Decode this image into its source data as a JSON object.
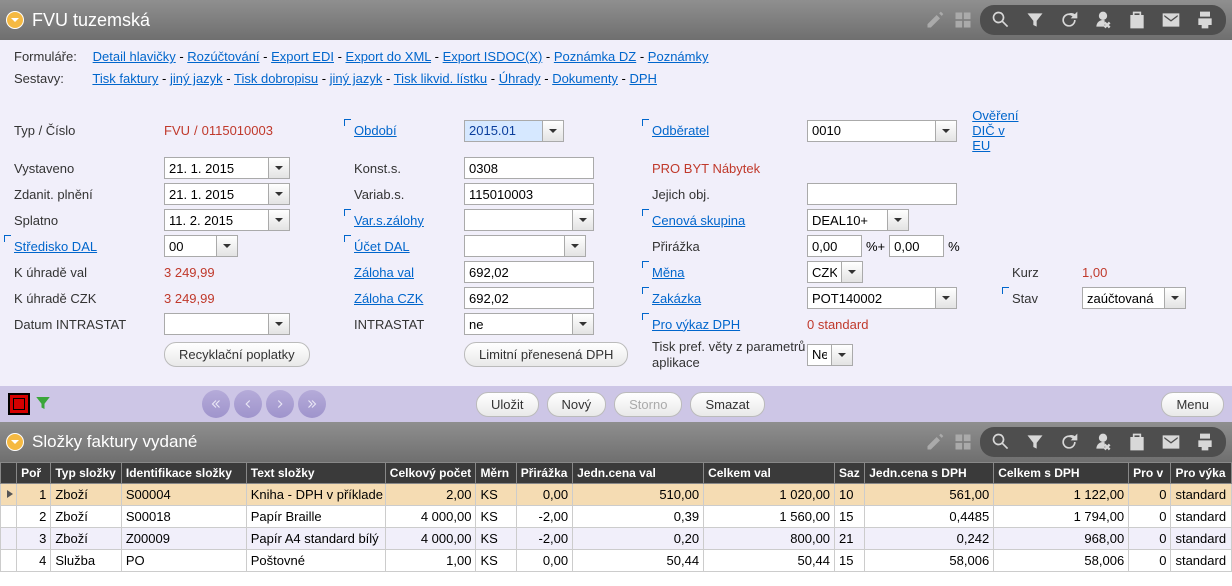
{
  "header": {
    "title": "FVU tuzemská"
  },
  "linksRow1Label": "Formuláře:",
  "linksRow1": [
    "Detail hlavičky",
    "Rozúčtování",
    "Export EDI",
    "Export do XML",
    "Export ISDOC(X)",
    "Poznámka DZ",
    "Poznámky"
  ],
  "linksRow2Label": "Sestavy:",
  "linksRow2": [
    "Tisk faktury",
    "jiný jazyk",
    "Tisk dobropisu",
    "jiný jazyk",
    "Tisk likvid. lístku",
    "Úhrady",
    "Dokumenty",
    "DPH"
  ],
  "form": {
    "typCisloLabel": "Typ / Číslo",
    "typ": "FVU",
    "cislo": "0115010003",
    "obdobiLabel": "Období",
    "obdobi": "2015.01",
    "odberatelLabel": "Odběratel",
    "odberatel": "0010",
    "overeniDicLabel": "Ověření DIČ v EU",
    "vystavenoLabel": "Vystaveno",
    "vystaveno": "21. 1. 2015",
    "konstSLabel": "Konst.s.",
    "konstS": "0308",
    "customerName": "PRO BYT Nábytek",
    "zdanitLabel": "Zdanit. plnění",
    "zdanit": "21. 1. 2015",
    "variabSLabel": "Variab.s.",
    "variabS": "115010003",
    "jejichObjLabel": "Jejich obj.",
    "jejichObj": "",
    "splatnoLabel": "Splatno",
    "splatno": "11. 2. 2015",
    "varsZalohyLabel": "Var.s.zálohy",
    "varsZalohy": "",
    "cenovaSkupinaLabel": "Cenová skupina",
    "cenovaSkupina": "DEAL10+",
    "strediskoDalLabel": "Středisko DAL",
    "strediskoDal": "00",
    "ucetDalLabel": "Účet DAL",
    "ucetDal": "",
    "prirazkaLabel": "Přirážka",
    "prirazka1": "0,00",
    "prirazkaPM": "%+",
    "prirazka2": "0,00",
    "prirazkaPct": "%",
    "kUhradeValLabel": "K úhradě val",
    "kUhradeVal": "3 249,99",
    "zalohaValLabel": "Záloha val",
    "zalohaVal": "692,02",
    "menaLabel": "Měna",
    "mena": "CZK",
    "kurzLabel": "Kurz",
    "kurz": "1,00",
    "kUhradeCzkLabel": "K úhradě CZK",
    "kUhradeCzk": "3 249,99",
    "zalohaCzkLabel": "Záloha CZK",
    "zalohaCzk": "692,02",
    "zakazkaLabel": "Zakázka",
    "zakazka": "POT140002",
    "stavLabel": "Stav",
    "stav": "zaúčtovaná",
    "datumIntrastatLabel": "Datum INTRASTAT",
    "datumIntrastat": "",
    "intrastatLabel": "INTRASTAT",
    "intrastat": "ne",
    "proVykazDphLabel": "Pro výkaz DPH",
    "proVykazDph": "0  standard",
    "recyklBtn": "Recyklační poplatky",
    "limitBtn": "Limitní přenesená DPH",
    "tiskPrefLabel": "Tisk pref. věty z parametrů aplikace",
    "tiskPref": "Ne"
  },
  "actions": {
    "save": "Uložit",
    "new": "Nový",
    "storno": "Storno",
    "delete": "Smazat",
    "menu": "Menu"
  },
  "subheader": {
    "title": "Složky faktury vydané"
  },
  "table": {
    "cols": [
      "",
      "Poř",
      "Typ složky",
      "Identifikace složky",
      "Text složky",
      "Celkový počet",
      "Měrn",
      "Přirážka",
      "Jedn.cena val",
      "Celkem val",
      "Saz",
      "Jedn.cena s DPH",
      "Celkem s DPH",
      "Pro v",
      "Pro výka"
    ],
    "rows": [
      {
        "por": "1",
        "typ": "Zboží",
        "ident": "S00004",
        "text": "Kniha - DPH v příklade",
        "pocet": "2,00",
        "mern": "KS",
        "prir": "0,00",
        "jcval": "510,00",
        "cval": "1 020,00",
        "saz": "10",
        "jcdph": "561,00",
        "cdph": "1 122,00",
        "prov": "0",
        "provy": "standard",
        "sel": true
      },
      {
        "por": "2",
        "typ": "Zboží",
        "ident": "S00018",
        "text": "Papír Braille",
        "pocet": "4 000,00",
        "mern": "KS",
        "prir": "-2,00",
        "jcval": "0,39",
        "cval": "1 560,00",
        "saz": "15",
        "jcdph": "0,4485",
        "cdph": "1 794,00",
        "prov": "0",
        "provy": "standard"
      },
      {
        "por": "3",
        "typ": "Zboží",
        "ident": "Z00009",
        "text": "Papír A4 standard bílý",
        "pocet": "4 000,00",
        "mern": "KS",
        "prir": "-2,00",
        "jcval": "0,20",
        "cval": "800,00",
        "saz": "21",
        "jcdph": "0,242",
        "cdph": "968,00",
        "prov": "0",
        "provy": "standard",
        "alt": true
      },
      {
        "por": "4",
        "typ": "Služba",
        "ident": "PO",
        "text": "Poštovné",
        "pocet": "1,00",
        "mern": "KS",
        "prir": "0,00",
        "jcval": "50,44",
        "cval": "50,44",
        "saz": "15",
        "jcdph": "58,006",
        "cdph": "58,006",
        "prov": "0",
        "provy": "standard"
      }
    ]
  }
}
